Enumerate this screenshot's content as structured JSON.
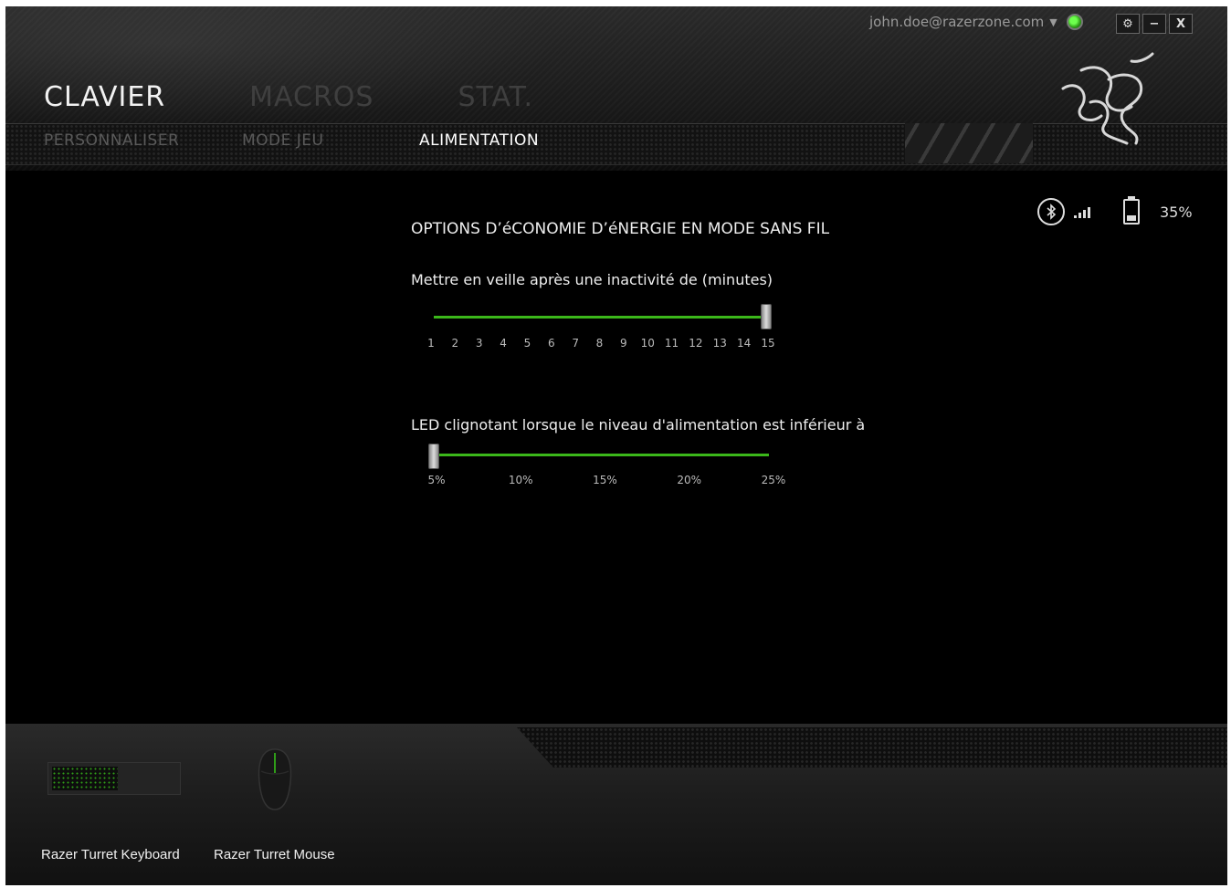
{
  "account": {
    "email": "john.doe@razerzone.com",
    "dropdown_icon": "triangle-down-icon",
    "status_icon": "status-indicator-icon"
  },
  "window_buttons": {
    "settings": "⚙",
    "minimize": "−",
    "close": "X"
  },
  "main_tabs": [
    {
      "label": "CLAVIER",
      "active": true
    },
    {
      "label": "MACROS",
      "active": false
    },
    {
      "label": "STAT.",
      "active": false
    }
  ],
  "sub_tabs": [
    {
      "label": "PERSONNALISER",
      "active": false
    },
    {
      "label": "MODE JEU",
      "active": false
    },
    {
      "label": "ALIMENTATION",
      "active": true
    }
  ],
  "status": {
    "connection_icon": "bluetooth-icon",
    "signal_icon": "signal-strength-icon",
    "battery_icon": "battery-icon",
    "battery_percent": "35%",
    "battery_level": 0.35
  },
  "power": {
    "section_title": "OPTIONS D’éCONOMIE D’éNERGIE EN MODE SANS FIL",
    "sleep": {
      "label": "Mettre en veille après une inactivité de (minutes)",
      "ticks": [
        "1",
        "2",
        "3",
        "4",
        "5",
        "6",
        "7",
        "8",
        "9",
        "10",
        "11",
        "12",
        "13",
        "14",
        "15"
      ],
      "value": 15
    },
    "led": {
      "label": "LED clignotant lorsque le niveau d'alimentation est inférieur à",
      "ticks": [
        "5%",
        "10%",
        "15%",
        "20%",
        "25%"
      ],
      "value": "5%"
    }
  },
  "devices": [
    {
      "name": "Razer Turret Keyboard",
      "icon": "keyboard-icon"
    },
    {
      "name": "Razer Turret Mouse",
      "icon": "mouse-icon"
    }
  ],
  "colors": {
    "accent_green": "#3bb71a",
    "background": "#000000"
  }
}
